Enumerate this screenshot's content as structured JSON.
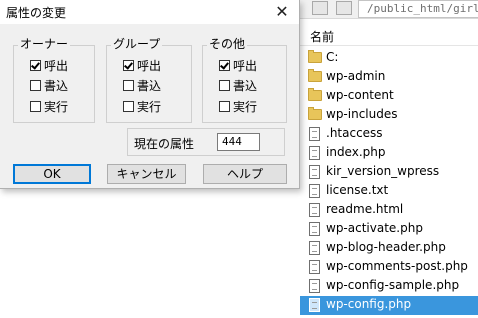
{
  "browser": {
    "path": "/public_html/girls-c",
    "column_name": "名前",
    "files": [
      {
        "name": "C:",
        "type": "folder"
      },
      {
        "name": "wp-admin",
        "type": "folder"
      },
      {
        "name": "wp-content",
        "type": "folder"
      },
      {
        "name": "wp-includes",
        "type": "folder"
      },
      {
        "name": ".htaccess",
        "type": "file"
      },
      {
        "name": "index.php",
        "type": "file"
      },
      {
        "name": "kir_version_wpress",
        "type": "file"
      },
      {
        "name": "license.txt",
        "type": "file"
      },
      {
        "name": "readme.html",
        "type": "file"
      },
      {
        "name": "wp-activate.php",
        "type": "file"
      },
      {
        "name": "wp-blog-header.php",
        "type": "file"
      },
      {
        "name": "wp-comments-post.php",
        "type": "file"
      },
      {
        "name": "wp-config-sample.php",
        "type": "file"
      },
      {
        "name": "wp-config.php",
        "type": "file",
        "selected": true
      }
    ]
  },
  "dialog": {
    "title": "属性の変更",
    "close_glyph": "✕",
    "groups": [
      {
        "title": "オーナー",
        "read": "呼出",
        "read_checked": true,
        "write": "書込",
        "write_checked": false,
        "exec": "実行",
        "exec_checked": false
      },
      {
        "title": "グループ",
        "read": "呼出",
        "read_checked": true,
        "write": "書込",
        "write_checked": false,
        "exec": "実行",
        "exec_checked": false
      },
      {
        "title": "その他",
        "read": "呼出",
        "read_checked": true,
        "write": "書込",
        "write_checked": false,
        "exec": "実行",
        "exec_checked": false
      }
    ],
    "attr_label": "現在の属性",
    "attr_value": "444",
    "ok_label": "OK",
    "cancel_label": "キャンセル",
    "help_label": "ヘルプ"
  },
  "colors": {
    "selection": "#3a96dd",
    "default_button_border": "#0078d7",
    "folder": "#e8c55a"
  },
  "icons": {
    "folder": "folder-icon",
    "file": "file-icon",
    "close": "close-icon"
  }
}
